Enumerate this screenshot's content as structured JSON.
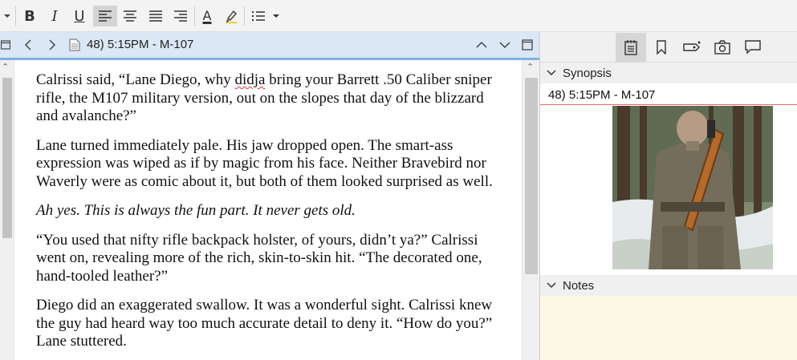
{
  "toolbar": {
    "bold": "B",
    "italic": "I",
    "underline": "U",
    "font_color": "A",
    "icons": [
      "dropdown-arrow-icon",
      "bold-icon",
      "italic-icon",
      "underline-icon",
      "align-left-icon",
      "align-center-icon",
      "justify-icon",
      "align-right-icon",
      "font-color-icon",
      "highlighter-icon",
      "list-icon",
      "list-dropdown-icon"
    ]
  },
  "editor": {
    "title": "48) 5:15PM - M-107",
    "paragraphs": [
      {
        "pre": "Calrissi said, “Lane Diego, why ",
        "flag": "didja",
        "post": " bring your Barrett .50 Caliber sniper rifle, the M107 military version, out on the slopes that day of the blizzard and avalanche?”"
      },
      {
        "text": "Lane turned immediately pale. His jaw dropped open. The smart-ass expression was wiped as if by magic from his face. Neither Bravebird nor Waverly were as comic about it, but both of them looked surprised as well."
      },
      {
        "text": "Ah yes. This is always the fun part. It never gets old."
      },
      {
        "text": "“You used that nifty rifle backpack holster, of yours, didn’t ya?” Calrissi went on, revealing more of the rich, skin-to-skin hit. “The decorated one, hand-tooled leather?”"
      },
      {
        "text": "Diego did an exaggerated swallow. It was a wonderful sight. Calrissi knew the guy had heard way too much accurate detail to deny it. “How do you?” Lane stuttered."
      }
    ]
  },
  "inspector": {
    "synopsis_label": "Synopsis",
    "synopsis_title": "48) 5:15PM - M-107",
    "notes_label": "Notes"
  },
  "colors": {
    "header_bg": "#dbe7f4",
    "header_accent": "#7fb1e4",
    "notes_bg": "#fdf8e3",
    "spell_error": "#d33"
  }
}
